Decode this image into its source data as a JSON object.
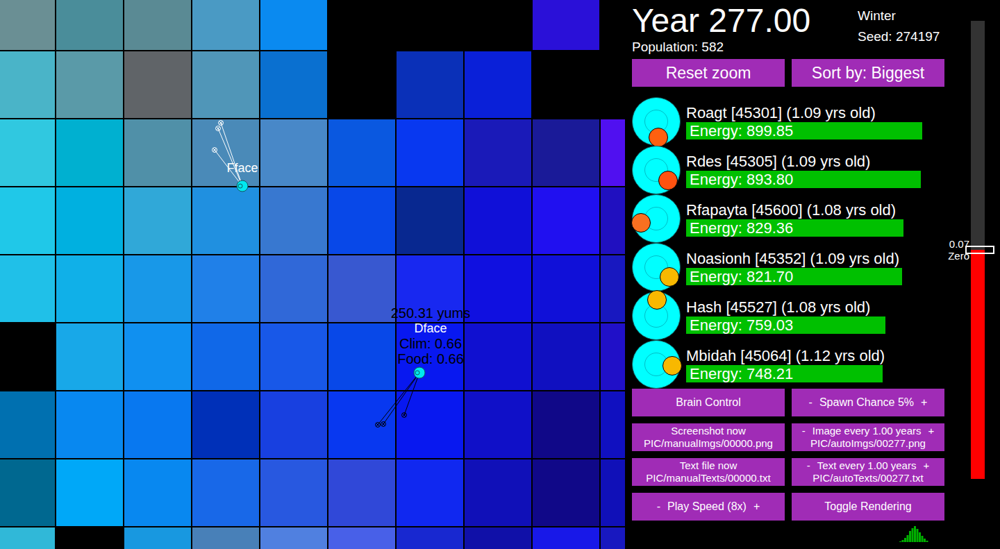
{
  "header": {
    "year": "Year 277.00",
    "season": "Winter",
    "seed": "Seed: 274197",
    "population": "Population: 582"
  },
  "topButtons": [
    "Reset zoom",
    "Sort by: Biggest"
  ],
  "creatures": [
    {
      "name": "Roagt [45301] (1.09 yrs old)",
      "energy": "Energy: 899.85",
      "level": 0.9,
      "color": "#ff6010",
      "facing": 83
    },
    {
      "name": "Rdes [45305] (1.09 yrs old)",
      "energy": "Energy: 893.80",
      "level": 0.894,
      "color": "#ff5210",
      "facing": 42
    },
    {
      "name": "Rfapayta [45600] (1.08 yrs old)",
      "energy": "Energy: 829.36",
      "level": 0.829,
      "color": "#f87020",
      "facing": 164
    },
    {
      "name": "Noasionh [45352] (1.09 yrs old)",
      "energy": "Energy: 821.70",
      "level": 0.822,
      "color": "#f8b800",
      "facing": 36
    },
    {
      "name": "Hash [45527] (1.08 yrs old)",
      "energy": "Energy: 759.03",
      "level": 0.759,
      "color": "#f8b800",
      "facing": 272
    },
    {
      "name": "Mbidah [45064] (1.12 yrs old)",
      "energy": "Energy: 748.21",
      "level": 0.748,
      "color": "#f8b800",
      "facing": 5
    }
  ],
  "controls": [
    {
      "kind": "plain",
      "label": "Brain Control"
    },
    {
      "kind": "stepper",
      "minus": "-",
      "label": "Spawn Chance 5%",
      "plus": "+"
    },
    {
      "kind": "plain",
      "label": "Screenshot now",
      "sub": "PIC/manualImgs/00000.png"
    },
    {
      "kind": "stepper",
      "minus": "-",
      "label": "Image every 1.00 years",
      "plus": "+",
      "sub": "PIC/autoImgs/00277.png"
    },
    {
      "kind": "plain",
      "label": "Text file now",
      "sub": "PIC/manualTexts/00000.txt"
    },
    {
      "kind": "stepper",
      "minus": "-",
      "label": "Text every 1.00 years",
      "plus": "+",
      "sub": "PIC/autoTexts/00277.txt"
    },
    {
      "kind": "stepper",
      "minus": "-",
      "label": "Play Speed (8x)",
      "plus": "+"
    },
    {
      "kind": "plain",
      "label": "Toggle Rendering"
    }
  ],
  "temperature": {
    "level": 0.5,
    "reading": "0.07",
    "label": "Zero"
  },
  "map": {
    "tiles": [
      [
        "#6a8f94",
        "#4a8d9a",
        "#5a8a94",
        "#4a9ac4",
        "#0a8af0",
        "#000000",
        "#000000",
        "#000000",
        "#2a10d8",
        "#000000"
      ],
      [
        "#4ab4c8",
        "#5a9aa8",
        "#606468",
        "#5096b8",
        "#0a70d0",
        "#000000",
        "#0a30b8",
        "#0a20d8",
        "#000000",
        "#000000"
      ],
      [
        "#30c8e0",
        "#00b0d0",
        "#5090a8",
        "#4a8ab8",
        "#4888c8",
        "#0a58e0",
        "#0838f0",
        "#1a1ab8",
        "#1a1a98",
        "#5010f0"
      ],
      [
        "#20c8e8",
        "#00b0e0",
        "#30a8d8",
        "#2090e0",
        "#3878d0",
        "#0848e8",
        "#082890",
        "#1010d8",
        "#2010f0",
        "#2010c0"
      ],
      [
        "#20c0e8",
        "#10b0e8",
        "#1898e8",
        "#2080e8",
        "#3068d8",
        "#3858d0",
        "#1828f0",
        "#1010e0",
        "#1010d8",
        "#1818c0"
      ],
      [
        "#000000",
        "#18a8e8",
        "#1090f0",
        "#1068e8",
        "#1858e8",
        "#0848e8",
        "#0818f0",
        "#1010d0",
        "#1010c0",
        "#2010c8"
      ],
      [
        "#0070b0",
        "#0888f0",
        "#0878f0",
        "#0030b8",
        "#1840e0",
        "#0838f0",
        "#0818f0",
        "#1010c8",
        "#100888",
        "#1010c0"
      ],
      [
        "#006890",
        "#00a8f8",
        "#0888f0",
        "#1868e8",
        "#2858e0",
        "#3048d8",
        "#1028f0",
        "#1010b8",
        "#100888",
        "#1010b8"
      ],
      [
        "#30b8d8",
        "#000000",
        "#1898e0",
        "#4880b8",
        "#5080e0",
        "#4860e8",
        "#1828d0",
        "#1010a8",
        "#1818e8",
        "#1818c0"
      ]
    ],
    "creatures": [
      {
        "name": "Fface",
        "selected": false,
        "info": []
      },
      {
        "name": "Dface",
        "selected": true,
        "info": [
          "250.31 yums",
          "Clim: 0.66",
          "Food: 0.66"
        ]
      }
    ]
  },
  "histogram": {
    "values": [
      1,
      3,
      6,
      10,
      16,
      20,
      23,
      19,
      14,
      9,
      5,
      2
    ]
  }
}
